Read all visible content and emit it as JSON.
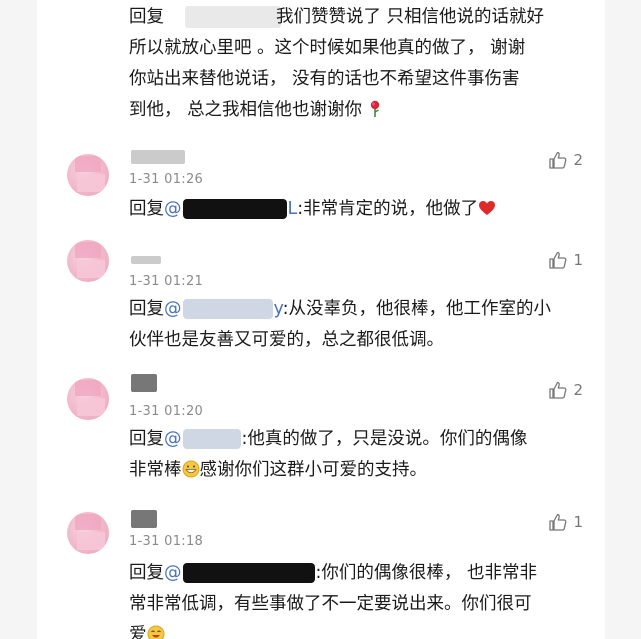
{
  "comments": [
    {
      "reply_prefix": "回复",
      "lines": [
        "我们赞赞说了 只相信他说的话就好",
        "所以就放心里吧 。这个时候如果他真的做了， 谢谢",
        "你站出来替他说话， 没有的话也不希望这件事伤害",
        "到他， 总之我相信他也谢谢你"
      ],
      "emoji": "rose"
    },
    {
      "timestamp": "1-31 01:26",
      "likes": "2",
      "reply_prefix": "回复",
      "mention_tail": "L",
      "text": ":非常肯定的说，他做了",
      "emoji": "heart"
    },
    {
      "timestamp": "1-31 01:21",
      "likes": "1",
      "reply_prefix": "回复",
      "mention": "@",
      "mention_tail": "y",
      "line1": ":从没辜负，他很棒，他工作室的小",
      "line2": "伙伴也是友善又可爱的，总之都很低调。"
    },
    {
      "timestamp": "1-31 01:20",
      "likes": "2",
      "reply_prefix": "回复",
      "mention": "@",
      "line1": ":他真的做了，只是没说。你们的偶像",
      "line2a": "非常棒",
      "line2b": "感谢你们这群小可爱的支持。",
      "emoji": "grin"
    },
    {
      "timestamp": "1-31 01:18",
      "likes": "1",
      "reply_prefix": "回复",
      "mention": "@",
      "line1": ":你们的偶像很棒， 也非常非",
      "line2": "常非常低调，有些事做了不一定要说出来。你们很可",
      "line3": "爱",
      "emoji": "laugh"
    }
  ],
  "colors": {
    "mention": "#4a72b8",
    "text": "#1a1a1a",
    "meta": "#8a8a8a",
    "heart": "#e02a2a"
  },
  "icons": {
    "like": "thumbs-up-icon",
    "rose": "rose-icon",
    "heart": "heart-icon",
    "grin": "grin-emoji-icon",
    "laugh": "laugh-emoji-icon"
  }
}
